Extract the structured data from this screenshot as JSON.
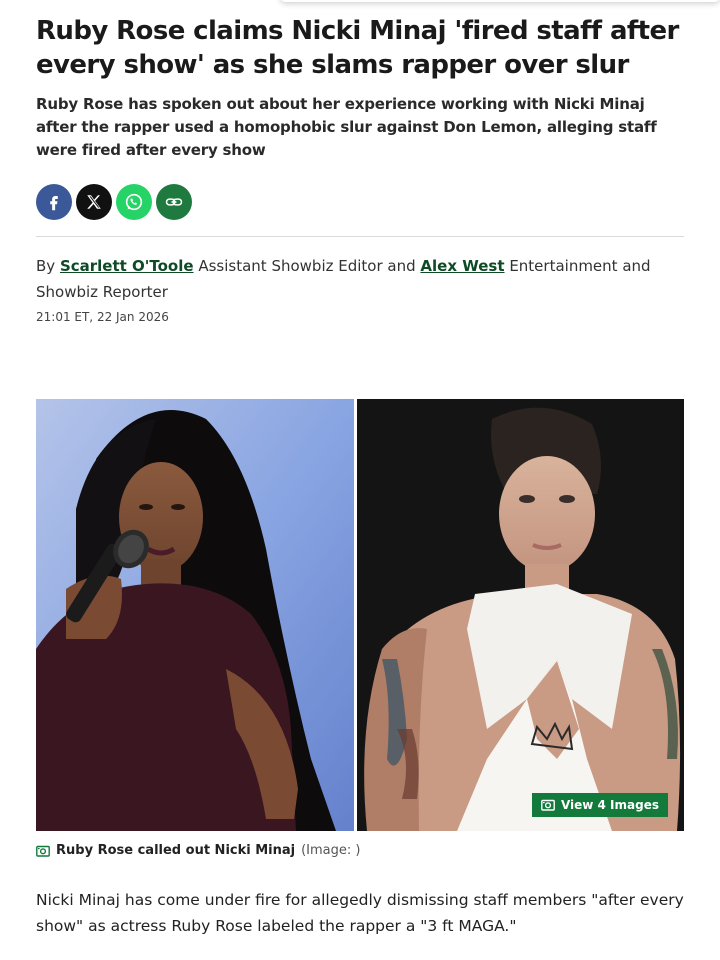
{
  "article": {
    "headline": "Ruby Rose claims Nicki Minaj 'fired staff after every show' as she slams rapper over slur",
    "standfirst": "Ruby Rose has spoken out about her experience working with Nicki Minaj after the rapper used a homophobic slur against Don Lemon, alleging staff were fired after every show",
    "byline": {
      "prefix": "By",
      "author1_name": "Scarlett O'Toole",
      "author1_role": "Assistant Showbiz Editor and",
      "author2_name": "Alex West",
      "author2_role": "Entertainment and Showbiz Reporter"
    },
    "timestamp": "21:01 ET, 22 Jan 2026",
    "gallery": {
      "view_label": "View 4 Images",
      "caption": "Ruby Rose called out Nicki Minaj",
      "credit": "(Image: )"
    },
    "first_paragraph": "Nicki Minaj has come under fire for allegedly dismissing staff members \"after every show\" as actress Ruby Rose labeled the rapper a \"3 ft MAGA.\""
  },
  "share": {
    "icons": [
      "facebook-icon",
      "x-icon",
      "whatsapp-icon",
      "link-icon"
    ]
  },
  "colors": {
    "accent": "#137a3c",
    "link": "#0d4a25",
    "facebook": "#3b5998",
    "whatsapp": "#25d366"
  }
}
